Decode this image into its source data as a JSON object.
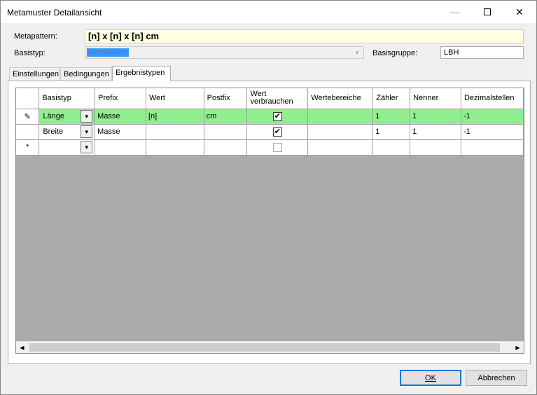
{
  "window": {
    "title": "Metamuster Detailansicht",
    "minimize": "—",
    "close": "✕"
  },
  "form": {
    "metapattern_label": "Metapattern:",
    "metapattern_value": "[n] x [n] x [n] cm",
    "basistyp_label": "Basistyp:",
    "basistyp_value": "Dimensionen",
    "basisgruppe_label": "Basisgruppe:",
    "basisgruppe_value": "LBH"
  },
  "tabs": [
    {
      "label": "Einstellungen"
    },
    {
      "label": "Bedingungen"
    },
    {
      "label": "Ergebnistypen"
    }
  ],
  "grid": {
    "columns": [
      {
        "label": "Basistyp"
      },
      {
        "label": "Prefix"
      },
      {
        "label": "Wert"
      },
      {
        "label": "Postfix"
      },
      {
        "label": "Wert verbrauchen"
      },
      {
        "label": "Wertebereiche"
      },
      {
        "label": "Zähler"
      },
      {
        "label": "Nenner"
      },
      {
        "label": "Dezimalstellen"
      }
    ],
    "rows": [
      {
        "marker": "✎",
        "basistyp": "Länge",
        "prefix": "Masse",
        "wert": "[n]",
        "postfix": "cm",
        "verbrauchen": true,
        "wertebereiche": "",
        "zaehler": "1",
        "nenner": "1",
        "dezimal": "-1"
      },
      {
        "marker": "",
        "basistyp": "Breite",
        "prefix": "Masse",
        "wert": "",
        "postfix": "",
        "verbrauchen": true,
        "wertebereiche": "",
        "zaehler": "1",
        "nenner": "1",
        "dezimal": "-1"
      }
    ],
    "new_row_marker": "*",
    "edit_row_color": "#90ee90"
  },
  "buttons": {
    "ok": "OK",
    "cancel": "Abbrechen"
  }
}
